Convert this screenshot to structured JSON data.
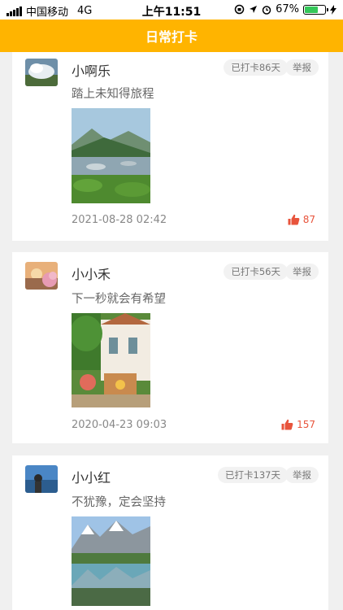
{
  "status_bar": {
    "carrier": "中国移动",
    "network": "4G",
    "time": "上午11:51",
    "battery_percent": "67%",
    "battery_level": 0.67
  },
  "nav": {
    "title": "日常打卡"
  },
  "posts": [
    {
      "username": "小啊乐",
      "streak": "已打卡86天",
      "report": "举报",
      "content": "踏上未知得旅程",
      "time": "2021-08-28 02:42",
      "likes": "87"
    },
    {
      "username": "小小禾",
      "streak": "已打卡56天",
      "report": "举报",
      "content": "下一秒就会有希望",
      "time": "2020-04-23 09:03",
      "likes": "157"
    },
    {
      "username": "小小红",
      "streak": "已打卡137天",
      "report": "举报",
      "content": "不犹豫，定会坚持"
    }
  ],
  "colors": {
    "accent": "#ffb400",
    "like": "#e8543c",
    "battery": "#34c759"
  }
}
